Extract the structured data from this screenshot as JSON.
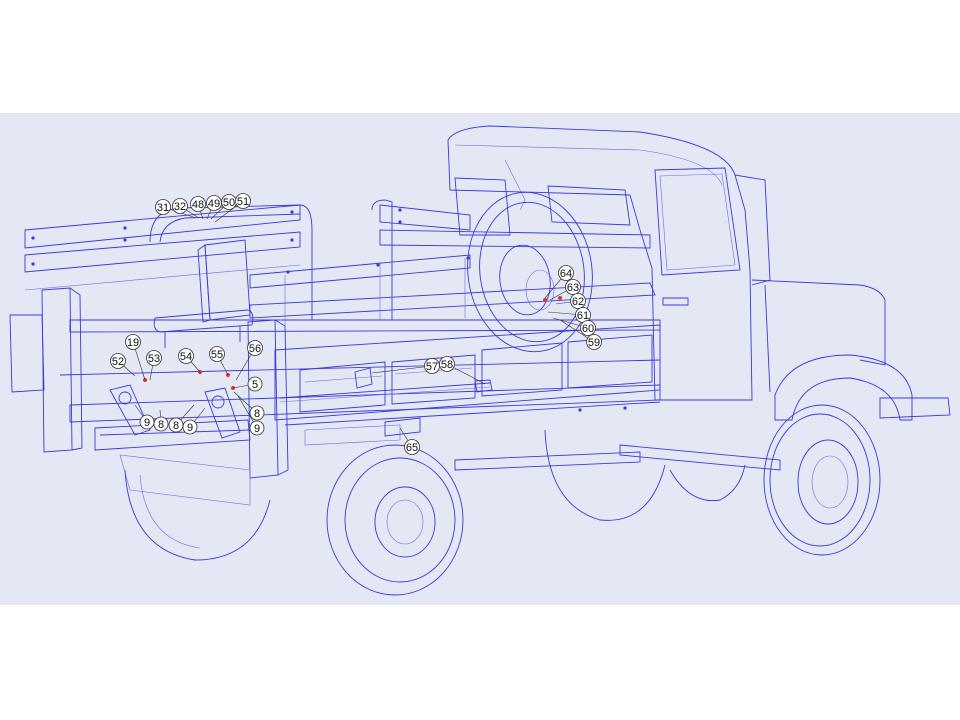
{
  "colors": {
    "background": "#e4e8f4",
    "outline": "#3a3ad8",
    "highlight": "#e03030"
  },
  "callouts": [
    {
      "id": "c-31",
      "label": "31"
    },
    {
      "id": "c-32",
      "label": "32"
    },
    {
      "id": "c-48",
      "label": "48"
    },
    {
      "id": "c-49",
      "label": "49"
    },
    {
      "id": "c-50",
      "label": "50"
    },
    {
      "id": "c-51",
      "label": "51"
    },
    {
      "id": "c-64",
      "label": "64"
    },
    {
      "id": "c-63",
      "label": "63"
    },
    {
      "id": "c-62",
      "label": "62"
    },
    {
      "id": "c-61",
      "label": "61"
    },
    {
      "id": "c-60",
      "label": "60"
    },
    {
      "id": "c-59",
      "label": "59"
    },
    {
      "id": "c-19",
      "label": "19"
    },
    {
      "id": "c-52",
      "label": "52"
    },
    {
      "id": "c-53",
      "label": "53"
    },
    {
      "id": "c-54",
      "label": "54"
    },
    {
      "id": "c-55",
      "label": "55"
    },
    {
      "id": "c-56",
      "label": "56"
    },
    {
      "id": "c-5",
      "label": "5"
    },
    {
      "id": "c-57",
      "label": "57"
    },
    {
      "id": "c-58",
      "label": "58"
    },
    {
      "id": "c-8a",
      "label": "8"
    },
    {
      "id": "c-9a",
      "label": "9"
    },
    {
      "id": "c-9b",
      "label": "9"
    },
    {
      "id": "c-8b",
      "label": "8"
    },
    {
      "id": "c-8c",
      "label": "8"
    },
    {
      "id": "c-9c",
      "label": "9"
    },
    {
      "id": "c-8d",
      "label": "8"
    },
    {
      "id": "c-9d",
      "label": "9"
    },
    {
      "id": "c-65",
      "label": "65"
    }
  ]
}
